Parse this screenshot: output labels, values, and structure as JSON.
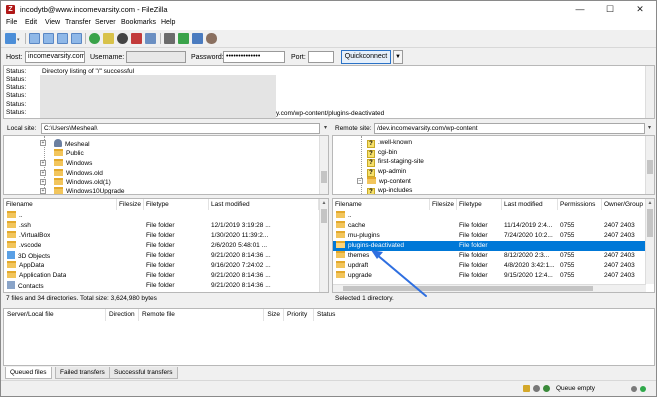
{
  "window": {
    "title": "incodytb@www.incomevarsity.com - FileZilla",
    "app_icon_glyph": "Z",
    "minimize": "—",
    "maximize": "☐",
    "close": "✕"
  },
  "menu": [
    "File",
    "Edit",
    "View",
    "Transfer",
    "Server",
    "Bookmarks",
    "Help"
  ],
  "toolbar": {
    "icons": [
      "site-manager-icon",
      "toggle-log-icon",
      "toggle-local-tree-icon",
      "toggle-remote-tree-icon",
      "toggle-queue-icon",
      "refresh-icon",
      "process-queue-icon",
      "cancel-icon",
      "disconnect-icon",
      "reconnect-icon",
      "filter-icon",
      "compare-icon",
      "sync-browse-icon",
      "search-icon"
    ]
  },
  "quickconnect": {
    "host_label": "Host:",
    "host_value": "incomevarsity.com",
    "username_label": "Username:",
    "username_value": "",
    "password_label": "Password:",
    "password_value": "••••••••••••••",
    "port_label": "Port:",
    "port_value": "",
    "button_label": "Quickconnect",
    "dropdown_arrow": "▼"
  },
  "log": {
    "lines": [
      {
        "label": "Status:",
        "text": "Directory listing of \"/\" successful"
      },
      {
        "label": "Status:",
        "text": ""
      },
      {
        "label": "Status:",
        "text": ""
      },
      {
        "label": "Status:",
        "text": ""
      },
      {
        "label": "Status:",
        "text": ""
      },
      {
        "label": "Status:",
        "text": ""
      }
    ],
    "tail_text": "y.com/wp-content/plugins-deactivated"
  },
  "local_site": {
    "label": "Local site:",
    "path": "C:\\Users\\Mesheal\\",
    "tree": [
      {
        "name": "Mesheal",
        "icon": "user",
        "expander": "+"
      },
      {
        "name": "Public",
        "icon": "folder",
        "expander": ""
      },
      {
        "name": "Windows",
        "icon": "folder",
        "expander": "+"
      },
      {
        "name": "Windows.old",
        "icon": "folder",
        "expander": "+"
      },
      {
        "name": "Windows.old(1)",
        "icon": "folder",
        "expander": "+"
      },
      {
        "name": "Windows10Upgrade",
        "icon": "folder",
        "expander": "+"
      }
    ],
    "columns": [
      "Filename",
      "Filesize",
      "Filetype",
      "Last modified"
    ],
    "rows": [
      {
        "name": "..",
        "type": "",
        "modified": "",
        "icon": "folder"
      },
      {
        "name": ".ssh",
        "type": "File folder",
        "modified": "12/1/2019 3:19:28 ...",
        "icon": "folder"
      },
      {
        "name": ".VirtualBox",
        "type": "File folder",
        "modified": "1/30/2020 11:39:2...",
        "icon": "folder"
      },
      {
        "name": ".vscode",
        "type": "File folder",
        "modified": "2/6/2020 5:48:01 ...",
        "icon": "folder"
      },
      {
        "name": "3D Objects",
        "type": "File folder",
        "modified": "9/21/2020 8:14:36 ...",
        "icon": "objects3d"
      },
      {
        "name": "AppData",
        "type": "File folder",
        "modified": "9/16/2020 7:24:02 ...",
        "icon": "folder"
      },
      {
        "name": "Application Data",
        "type": "File folder",
        "modified": "9/21/2020 8:14:36 ...",
        "icon": "folder"
      },
      {
        "name": "Contacts",
        "type": "File folder",
        "modified": "9/21/2020 8:14:36 ...",
        "icon": "contacts"
      }
    ],
    "status": "7 files and 34 directories. Total size: 3,624,980 bytes"
  },
  "remote_site": {
    "label": "Remote site:",
    "path": "/dev.incomevarsity.com/wp-content",
    "tree": [
      {
        "name": ".well-known",
        "icon": "question",
        "expander": ""
      },
      {
        "name": "cgi-bin",
        "icon": "question",
        "expander": ""
      },
      {
        "name": "first-staging-site",
        "icon": "question",
        "expander": ""
      },
      {
        "name": "wp-admin",
        "icon": "question",
        "expander": ""
      },
      {
        "name": "wp-content",
        "icon": "folder",
        "expander": "−"
      },
      {
        "name": "wp-includes",
        "icon": "question",
        "expander": ""
      }
    ],
    "columns": [
      "Filename",
      "Filesize",
      "Filetype",
      "Last modified",
      "Permissions",
      "Owner/Group"
    ],
    "rows": [
      {
        "name": "..",
        "type": "",
        "modified": "",
        "perms": "",
        "owner": "",
        "selected": false
      },
      {
        "name": "cache",
        "type": "File folder",
        "modified": "11/14/2019 2:4...",
        "perms": "0755",
        "owner": "2407 2403",
        "selected": false
      },
      {
        "name": "mu-plugins",
        "type": "File folder",
        "modified": "7/24/2020 10:2...",
        "perms": "0755",
        "owner": "2407 2403",
        "selected": false
      },
      {
        "name": "plugins-deactivated",
        "type": "File folder",
        "modified": "",
        "perms": "",
        "owner": "",
        "selected": true
      },
      {
        "name": "themes",
        "type": "File folder",
        "modified": "8/12/2020 2:3...",
        "perms": "0755",
        "owner": "2407 2403",
        "selected": false
      },
      {
        "name": "updraft",
        "type": "File folder",
        "modified": "4/8/2020 3:42:1...",
        "perms": "0755",
        "owner": "2407 2403",
        "selected": false
      },
      {
        "name": "upgrade",
        "type": "File folder",
        "modified": "9/15/2020 12:4...",
        "perms": "0755",
        "owner": "2407 2403",
        "selected": false
      }
    ],
    "status": "Selected 1 directory."
  },
  "queue": {
    "columns": [
      "Server/Local file",
      "Direction",
      "Remote file",
      "Size",
      "Priority",
      "Status"
    ],
    "tabs": [
      "Queued files",
      "Failed transfers",
      "Successful transfers"
    ]
  },
  "statusbar": {
    "queue_text": "Queue empty"
  },
  "colors": {
    "selection": "#0078d7",
    "arrow": "#2f6fe0"
  }
}
